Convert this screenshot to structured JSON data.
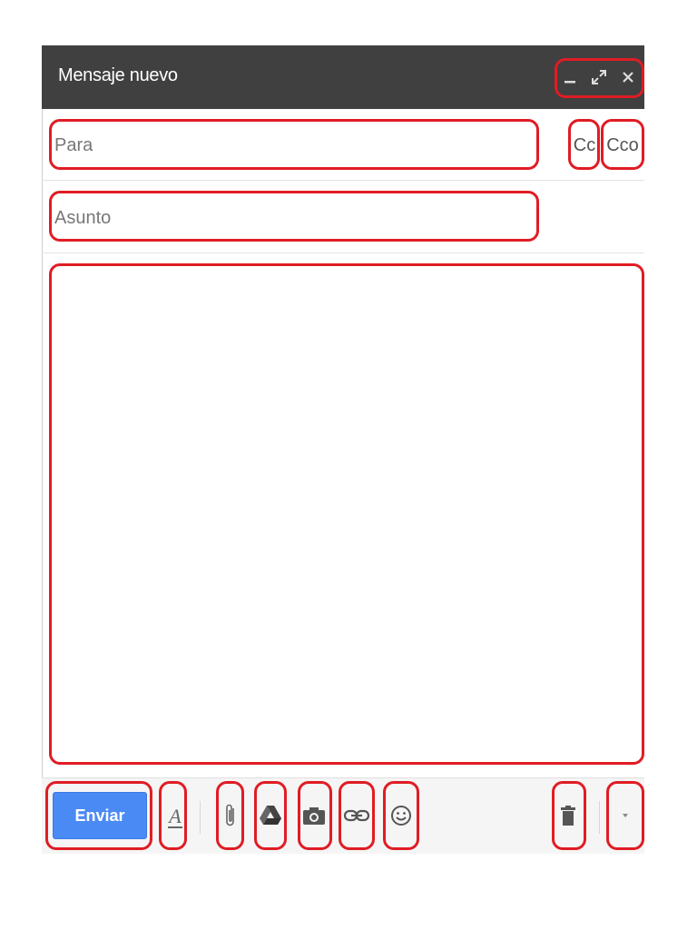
{
  "window": {
    "title": "Mensaje nuevo",
    "controls": [
      "minimize-icon",
      "expand-icon",
      "close-icon"
    ]
  },
  "recipients": {
    "to_placeholder": "Para",
    "cc_label": "Cc",
    "bcc_label": "Cco"
  },
  "subject": {
    "placeholder": "Asunto"
  },
  "body": {
    "value": ""
  },
  "toolbar": {
    "send_label": "Enviar",
    "tools": [
      "formatting-icon",
      "attach-icon",
      "drive-icon",
      "photo-icon",
      "link-icon",
      "emoji-icon",
      "trash-icon",
      "more-options-icon"
    ]
  },
  "colors": {
    "titlebar": "#404040",
    "send_button": "#4a8af4",
    "highlight": "#e01c24"
  }
}
